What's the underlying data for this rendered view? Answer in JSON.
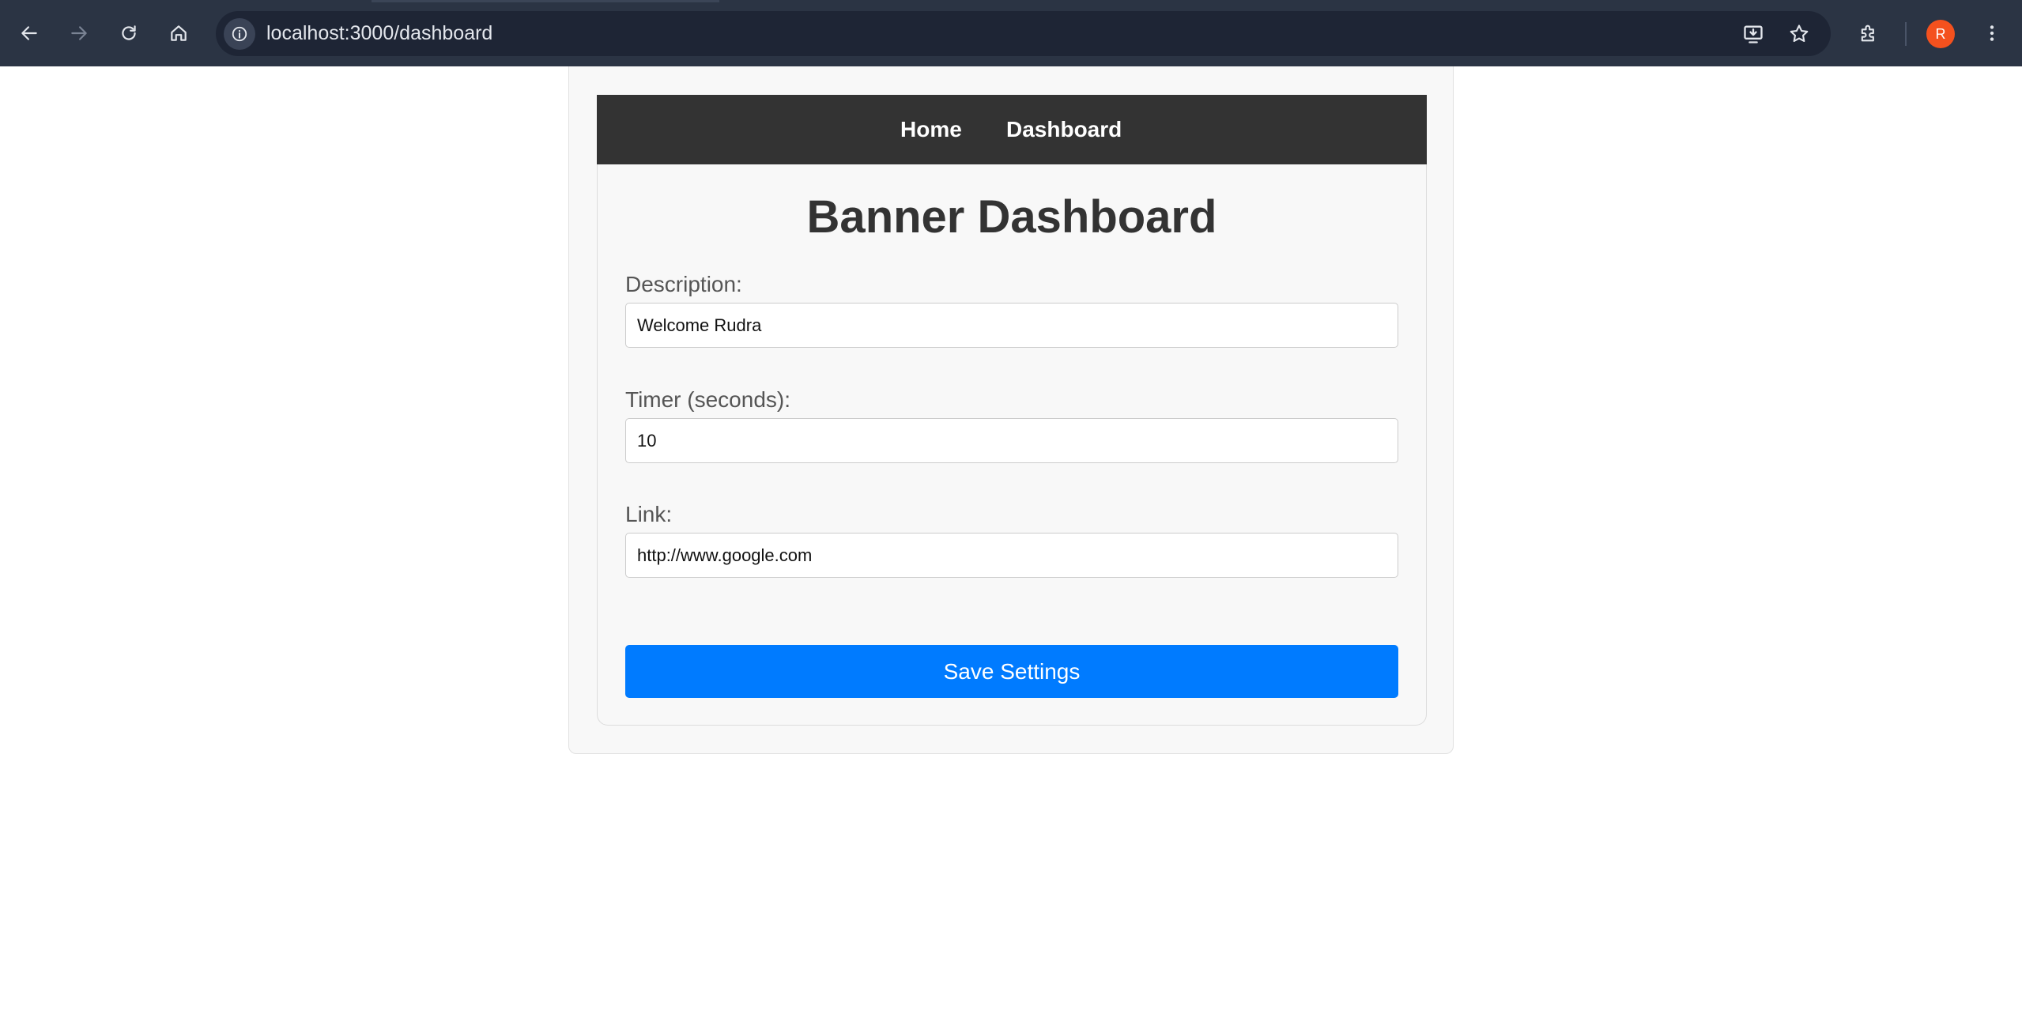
{
  "browser": {
    "url": "localhost:3000/dashboard",
    "profile_initial": "R",
    "icons": {
      "back": "back-arrow-icon",
      "forward": "forward-arrow-icon",
      "reload": "reload-icon",
      "home": "home-icon",
      "site_info": "info-icon",
      "install": "install-app-icon",
      "bookmark": "star-icon",
      "extensions": "puzzle-icon",
      "menu": "kebab-menu-icon"
    }
  },
  "nav": {
    "home_label": "Home",
    "dashboard_label": "Dashboard"
  },
  "main": {
    "title": "Banner Dashboard",
    "description": {
      "label": "Description:",
      "value": "Welcome Rudra"
    },
    "timer": {
      "label": "Timer (seconds):",
      "value": "10"
    },
    "link": {
      "label": "Link:",
      "value": "http://www.google.com"
    },
    "save_label": "Save Settings"
  },
  "colors": {
    "chrome_bg": "#2b3444",
    "nav_bg": "#333333",
    "primary": "#007bff",
    "avatar": "#f4511e"
  }
}
